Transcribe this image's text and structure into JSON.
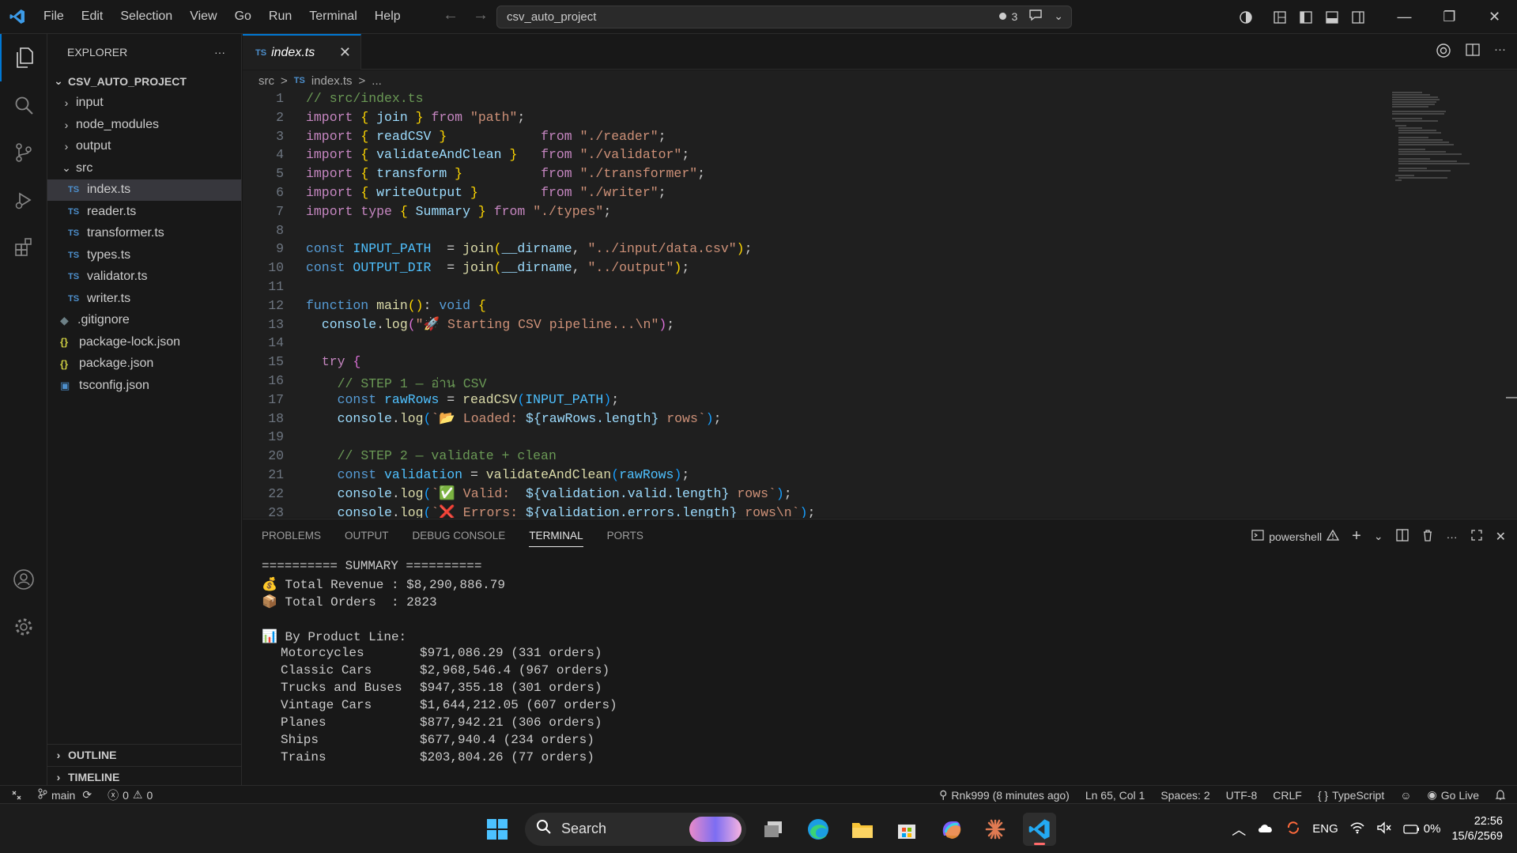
{
  "titlebar": {
    "menu": [
      "File",
      "Edit",
      "Selection",
      "View",
      "Go",
      "Run",
      "Terminal",
      "Help"
    ],
    "search": "csv_auto_project",
    "badge_count": "3"
  },
  "explorer": {
    "title": "EXPLORER",
    "project": "CSV_AUTO_PROJECT",
    "folders_top": [
      "input",
      "node_modules",
      "output"
    ],
    "src_folder": "src",
    "src_files": [
      "index.ts",
      "reader.ts",
      "transformer.ts",
      "types.ts",
      "validator.ts",
      "writer.ts"
    ],
    "root_files": [
      ".gitignore",
      "package-lock.json",
      "package.json",
      "tsconfig.json"
    ],
    "badge_ts": "TS",
    "badge_json": "{}",
    "outline": "OUTLINE",
    "timeline": "TIMELINE"
  },
  "editor": {
    "tab_badge": "TS",
    "tab_name": "index.ts",
    "breadcrumb": [
      "src",
      ">",
      "TS",
      "index.ts",
      ">",
      "..."
    ],
    "line_numbers": [
      "1",
      "2",
      "3",
      "4",
      "5",
      "6",
      "7",
      "8",
      "9",
      "10",
      "11",
      "12",
      "13",
      "14",
      "15",
      "16",
      "17",
      "18",
      "19",
      "20",
      "21",
      "22",
      "23"
    ],
    "code": {
      "l1": "// src/index.ts",
      "l2_a": "import",
      "l2_b": " { ",
      "l2_c": "join",
      "l2_d": " } ",
      "l2_e": "from",
      "l2_f": " \"path\"",
      "l2_g": ";",
      "l3_c": "readCSV",
      "l3_f": "\"./reader\"",
      "l4_c": "validateAndClean",
      "l4_f": "\"./validator\"",
      "l5_c": "transform",
      "l5_f": "\"./transformer\"",
      "l6_c": "writeOutput",
      "l6_f": "\"./writer\"",
      "l7_type": "type",
      "l7_c": "Summary",
      "l7_f": "\"./types\"",
      "const": "const",
      "l9_var": "INPUT_PATH",
      "l9_fn": "join",
      "l9_dir": "__dirname",
      "l9_str": "\"../input/data.csv\"",
      "l10_var": "OUTPUT_DIR",
      "l10_str": "\"../output\"",
      "l12_function": "function",
      "l12_name": "main",
      "l12_void": "void",
      "l13_obj": "console",
      "l13_fn": "log",
      "l13_str": "\"🚀 Starting CSV pipeline...\\n\"",
      "l15_try": "try",
      "l16": "// STEP 1 — อ่าน CSV",
      "l17_var": "rawRows",
      "l17_fn": "readCSV",
      "l17_arg": "INPUT_PATH",
      "l18_str_a": "`📂 Loaded: ",
      "l18_expr": "${rawRows.length}",
      "l18_str_b": " rows`",
      "l20": "// STEP 2 — validate + clean",
      "l21_var": "validation",
      "l21_fn": "validateAndClean",
      "l21_arg": "rawRows",
      "l22_str_a": "`✅ Valid:  ",
      "l22_expr": "${validation.valid.length}",
      "l22_str_b": " rows`",
      "l23_str_a": "`❌ Errors: ",
      "l23_expr": "${validation.errors.length}",
      "l23_str_b": " rows\\n`"
    }
  },
  "panel": {
    "tabs": [
      "PROBLEMS",
      "OUTPUT",
      "DEBUG CONSOLE",
      "TERMINAL",
      "PORTS"
    ],
    "shell": "powershell",
    "terminal": {
      "header": "========== SUMMARY ==========",
      "revenue": "💰 Total Revenue : $8,290,886.79",
      "orders": "📦 Total Orders  : 2823",
      "by_line": "📊 By Product Line:",
      "rows": [
        {
          "name": "Motorcycles",
          "value": "$971,086.29 (331 orders)"
        },
        {
          "name": "Classic Cars",
          "value": "$2,968,546.4 (967 orders)"
        },
        {
          "name": "Trucks and Buses",
          "value": "$947,355.18 (301 orders)"
        },
        {
          "name": "Vintage Cars",
          "value": "$1,644,212.05 (607 orders)"
        },
        {
          "name": "Planes",
          "value": "$877,942.21 (306 orders)"
        },
        {
          "name": "Ships",
          "value": "$677,940.4 (234 orders)"
        },
        {
          "name": "Trains",
          "value": "$203,804.26 (77 orders)"
        }
      ]
    }
  },
  "statusbar": {
    "branch": "main",
    "errors": "0",
    "warnings": "0",
    "blame": "Rnk999 (8 minutes ago)",
    "position": "Ln 65, Col 1",
    "spaces": "Spaces: 2",
    "encoding": "UTF-8",
    "eol": "CRLF",
    "language": "TypeScript",
    "golive": "Go Live"
  },
  "taskbar": {
    "search": "Search",
    "lang": "ENG",
    "battery": "0%",
    "time": "22:56",
    "date": "15/6/2569"
  },
  "colors": {
    "accent": "#0078d4",
    "background": "#1f1f1f",
    "keyword": "#c586c0",
    "string": "#ce9178",
    "comment": "#6a9955"
  }
}
